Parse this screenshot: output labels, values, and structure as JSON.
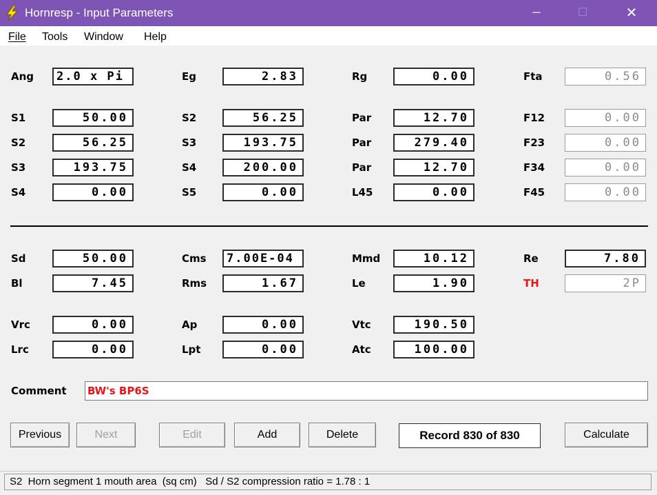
{
  "window": {
    "title": "Hornresp - Input Parameters",
    "title_bar_color": "#7e54b4",
    "controls": {
      "minimize": "─",
      "maximize": "☐",
      "close": "✕"
    }
  },
  "menu": {
    "file": "File",
    "tools": "Tools",
    "window": "Window",
    "help": "Help"
  },
  "horn": {
    "ang": {
      "label": "Ang",
      "value": "2.0 x Pi"
    },
    "eg": {
      "label": "Eg",
      "value": "2.83"
    },
    "rg": {
      "label": "Rg",
      "value": "0.00"
    },
    "fta": {
      "label": "Fta",
      "value": "0.56"
    },
    "r1": {
      "s1": {
        "label": "S1",
        "value": "50.00"
      },
      "s2": {
        "label": "S2",
        "value": "56.25"
      },
      "par": {
        "label": "Par",
        "value": "12.70"
      },
      "f12": {
        "label": "F12",
        "value": "0.00"
      }
    },
    "r2": {
      "s2": {
        "label": "S2",
        "value": "56.25"
      },
      "s3": {
        "label": "S3",
        "value": "193.75"
      },
      "par": {
        "label": "Par",
        "value": "279.40"
      },
      "f23": {
        "label": "F23",
        "value": "0.00"
      }
    },
    "r3": {
      "s3": {
        "label": "S3",
        "value": "193.75"
      },
      "s4": {
        "label": "S4",
        "value": "200.00"
      },
      "par": {
        "label": "Par",
        "value": "12.70"
      },
      "f34": {
        "label": "F34",
        "value": "0.00"
      }
    },
    "r4": {
      "s4": {
        "label": "S4",
        "value": "0.00"
      },
      "s5": {
        "label": "S5",
        "value": "0.00"
      },
      "l45": {
        "label": "L45",
        "value": "0.00"
      },
      "f45": {
        "label": "F45",
        "value": "0.00"
      }
    }
  },
  "driver": {
    "sd": {
      "label": "Sd",
      "value": "50.00"
    },
    "cms": {
      "label": "Cms",
      "value": "7.00E-04"
    },
    "mmd": {
      "label": "Mmd",
      "value": "10.12"
    },
    "re": {
      "label": "Re",
      "value": "7.80"
    },
    "bl": {
      "label": "Bl",
      "value": "7.45"
    },
    "rms": {
      "label": "Rms",
      "value": "1.67"
    },
    "le": {
      "label": "Le",
      "value": "1.90"
    },
    "th": {
      "label": "TH",
      "value": "2P"
    }
  },
  "chambers": {
    "vrc": {
      "label": "Vrc",
      "value": "0.00"
    },
    "ap": {
      "label": "Ap",
      "value": "0.00"
    },
    "vtc": {
      "label": "Vtc",
      "value": "190.50"
    },
    "lrc": {
      "label": "Lrc",
      "value": "0.00"
    },
    "lpt": {
      "label": "Lpt",
      "value": "0.00"
    },
    "atc": {
      "label": "Atc",
      "value": "100.00"
    }
  },
  "comment": {
    "label": "Comment",
    "value": "BW's BP6S",
    "color": "#e8141a"
  },
  "buttons": {
    "previous": "Previous",
    "next": "Next",
    "edit": "Edit",
    "add": "Add",
    "delete": "Delete",
    "calculate": "Calculate"
  },
  "record": "Record 830 of 830",
  "status": "S2  Horn segment 1 mouth area  (sq cm)   Sd / S2 compression ratio = 1.78 : 1"
}
